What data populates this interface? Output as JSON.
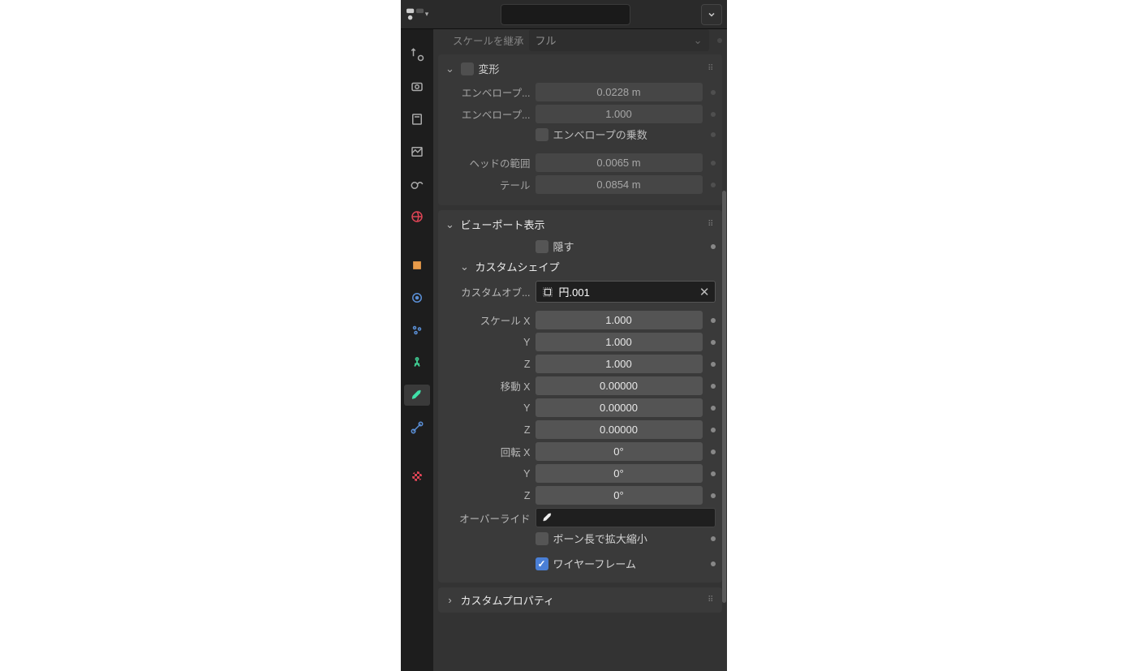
{
  "header": {
    "search_placeholder": ""
  },
  "inherit": {
    "label": "スケールを継承",
    "value": "フル"
  },
  "deform": {
    "title": "変形",
    "envelope_distance_label": "エンベロープ...",
    "envelope_distance": "0.0228 m",
    "envelope_weight_label": "エンベロープ...",
    "envelope_weight": "1.000",
    "envelope_mult_label": "エンベロープの乗数",
    "head_label": "ヘッドの範囲",
    "head": "0.0065 m",
    "tail_label": "テール",
    "tail": "0.0854 m"
  },
  "viewport": {
    "title": "ビューポート表示",
    "hide_label": "隠す",
    "custom_shape_title": "カスタムシェイプ",
    "custom_object_label": "カスタムオブ...",
    "custom_object_value": "円.001",
    "scale_x_label": "スケール X",
    "scale_x": "1.000",
    "y_label": "Y",
    "scale_y": "1.000",
    "z_label": "Z",
    "scale_z": "1.000",
    "trans_x_label": "移動 X",
    "trans_x": "0.00000",
    "trans_y": "0.00000",
    "trans_z": "0.00000",
    "rot_x_label": "回転 X",
    "rot_x": "0°",
    "rot_y": "0°",
    "rot_z": "0°",
    "override_label": "オーバーライド",
    "scale_bone_length_label": "ボーン長で拡大縮小",
    "wireframe_label": "ワイヤーフレーム"
  },
  "custom_props": {
    "title": "カスタムプロパティ"
  }
}
